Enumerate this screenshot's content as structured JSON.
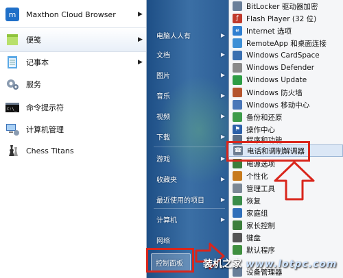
{
  "left_programs": [
    {
      "label": "Maxthon Cloud Browser",
      "icon": "maxthon-icon",
      "has_arrow": true
    },
    {
      "label": "便笺",
      "icon": "sticky-notes-icon",
      "has_arrow": true
    },
    {
      "label": "记事本",
      "icon": "notepad-icon",
      "has_arrow": true
    },
    {
      "label": "服务",
      "icon": "services-gear-icon",
      "has_arrow": false
    },
    {
      "label": "命令提示符",
      "icon": "command-prompt-icon",
      "has_arrow": false
    },
    {
      "label": "计算机管理",
      "icon": "computer-management-icon",
      "has_arrow": false
    },
    {
      "label": "Chess Titans",
      "icon": "chess-icon",
      "has_arrow": false
    }
  ],
  "middle_items": [
    {
      "label": "电脑人人有",
      "has_arrow": true
    },
    {
      "label": "文档",
      "has_arrow": true
    },
    {
      "label": "图片",
      "has_arrow": true
    },
    {
      "label": "音乐",
      "has_arrow": true
    },
    {
      "label": "视频",
      "has_arrow": true
    },
    {
      "label": "下载",
      "has_arrow": true
    },
    {
      "label": "游戏",
      "has_arrow": true
    },
    {
      "label": "收藏夹",
      "has_arrow": true
    },
    {
      "label": "最近使用的项目",
      "has_arrow": true
    },
    {
      "label": "计算机",
      "has_arrow": true
    },
    {
      "label": "网络",
      "has_arrow": false
    },
    {
      "label": "控制面板",
      "has_arrow": false
    }
  ],
  "submenu_items": [
    {
      "label": "BitLocker 驱动器加密",
      "icon_color": "#6a7f99"
    },
    {
      "label": "Flash Player (32 位)",
      "icon_color": "#c0392b"
    },
    {
      "label": "Internet 选项",
      "icon_color": "#2f7fd1"
    },
    {
      "label": "RemoteApp 和桌面连接",
      "icon_color": "#3d8fd6"
    },
    {
      "label": "Windows CardSpace",
      "icon_color": "#3a6fb0"
    },
    {
      "label": "Windows Defender",
      "icon_color": "#8a8a8a"
    },
    {
      "label": "Windows Update",
      "icon_color": "#2e9d45"
    },
    {
      "label": "Windows 防火墙",
      "icon_color": "#b5542c"
    },
    {
      "label": "Windows 移动中心",
      "icon_color": "#4a77b8"
    },
    {
      "label": "备份和还原",
      "icon_color": "#3d9b4a"
    },
    {
      "label": "操作中心",
      "icon_color": "#2b5fa8"
    },
    {
      "label": "程序和功能",
      "icon_color": "#5b6e86"
    },
    {
      "label": "电话和调制解调器",
      "icon_color": "#6f7f92"
    },
    {
      "label": "电源选项",
      "icon_color": "#3d7d3a"
    },
    {
      "label": "个性化",
      "icon_color": "#c77a1d"
    },
    {
      "label": "管理工具",
      "icon_color": "#7b8896"
    },
    {
      "label": "恢复",
      "icon_color": "#3a8c4a"
    },
    {
      "label": "家庭组",
      "icon_color": "#2f6fba"
    },
    {
      "label": "家长控制",
      "icon_color": "#3c7f3c"
    },
    {
      "label": "键盘",
      "icon_color": "#555555"
    },
    {
      "label": "默认程序",
      "icon_color": "#3f8f3f"
    },
    {
      "label": "设备管理器",
      "icon_color": "#6a7f99"
    }
  ],
  "watermark": {
    "text": "装机之家",
    "url": "www.lotpc.com"
  },
  "colors": {
    "annotation_red": "#d9261c",
    "menu_blue": "#2a5c94"
  }
}
